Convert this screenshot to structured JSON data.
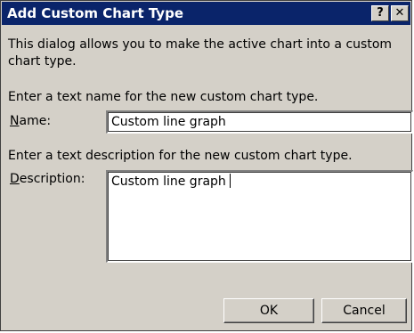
{
  "window": {
    "title": "Add Custom Chart Type",
    "help_label": "?",
    "close_label": "✕"
  },
  "content": {
    "intro": "This dialog allows you to make the active chart into a custom chart type.",
    "name_prompt": "Enter a text name for the new custom chart type.",
    "name_label_first": "N",
    "name_label_rest": "ame:",
    "name_value": "Custom line graph",
    "desc_prompt": "Enter a text description for the new custom chart type.",
    "desc_label_first": "D",
    "desc_label_rest": "escription:",
    "desc_value": "Custom line graph"
  },
  "buttons": {
    "ok": "OK",
    "cancel": "Cancel"
  },
  "colors": {
    "titlebar": "#0a246a",
    "dialog_face": "#d4d0c8"
  }
}
